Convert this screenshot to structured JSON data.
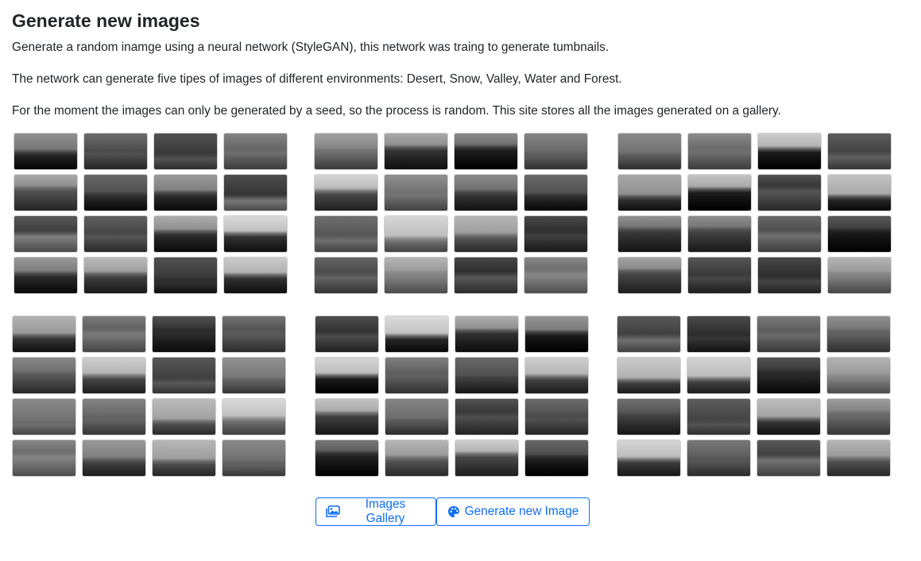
{
  "page": {
    "title": "Generate new images",
    "paragraphs": [
      "Generate a random inamge using a neural network (StyleGAN), this network was traing to generate tumbnails.",
      "The network can generate five tipes of images of different environments: Desert, Snow, Valley, Water and Forest.",
      "For the moment the images can only be generated by a seed, so the process is random. This site stores all the images generated on a gallery."
    ]
  },
  "image_grids": [
    {
      "name": "grid-1"
    },
    {
      "name": "grid-2"
    },
    {
      "name": "grid-3"
    },
    {
      "name": "grid-4"
    },
    {
      "name": "grid-5"
    },
    {
      "name": "grid-6"
    }
  ],
  "buttons": {
    "gallery": {
      "label": "Images Gallery",
      "icon": "images-icon"
    },
    "generate": {
      "label": "Generate new Image",
      "icon": "palette-icon"
    }
  },
  "colors": {
    "accent": "#0d6efd",
    "text": "#212529"
  }
}
